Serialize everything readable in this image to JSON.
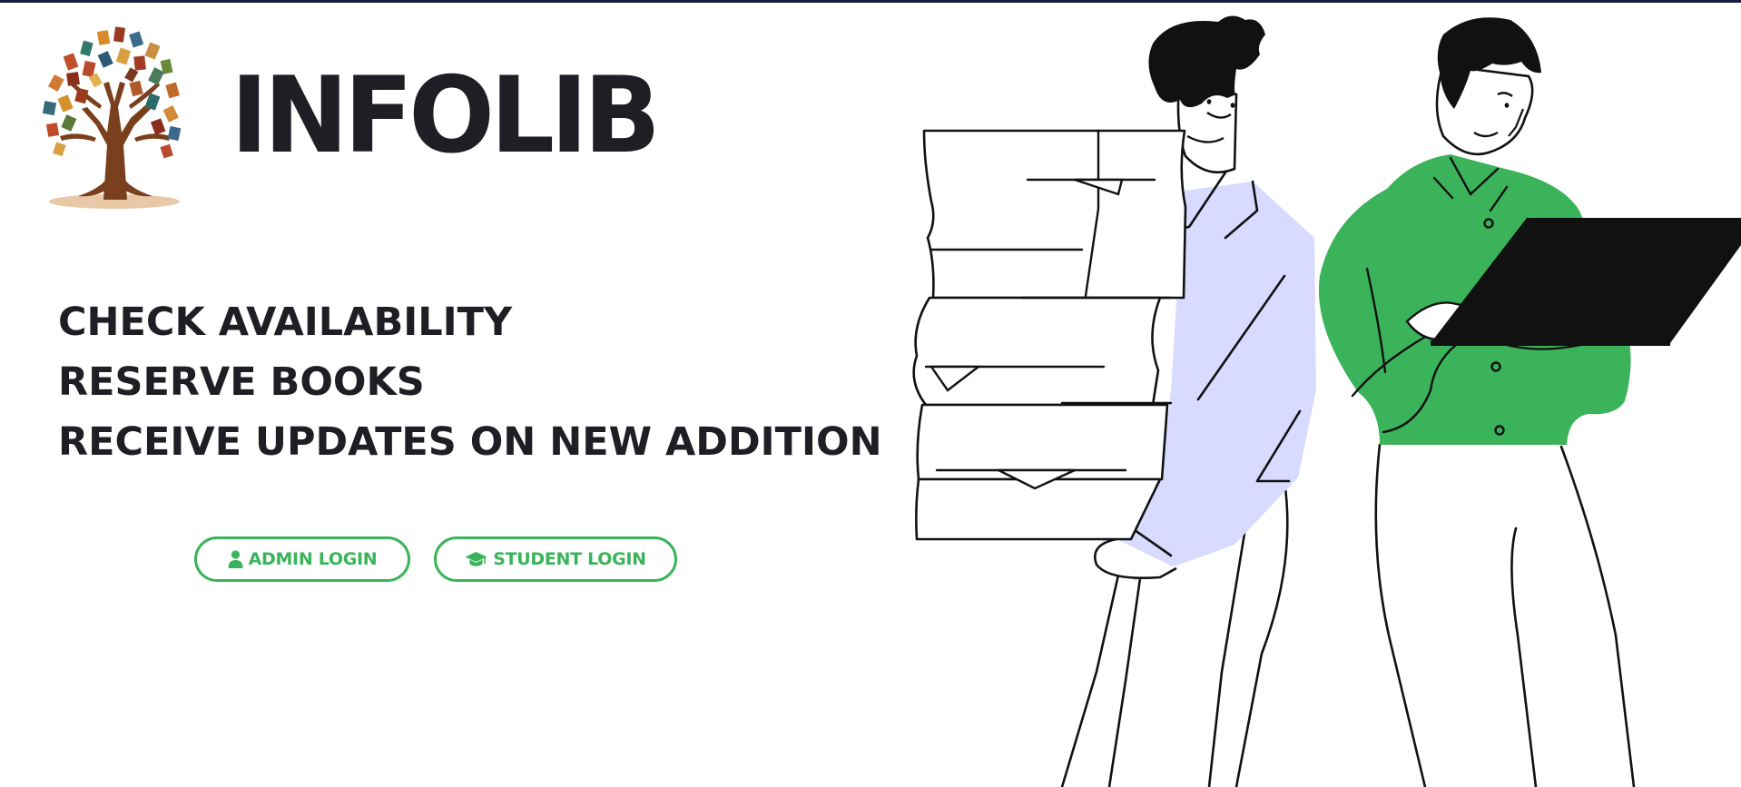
{
  "brand": {
    "name": "INFOLIB",
    "logo_icon": "book-tree-icon"
  },
  "taglines": [
    "CHECK AVAILABILITY",
    "RESERVE BOOKS",
    "RECEIVE UPDATES ON NEW ADDITION"
  ],
  "actions": {
    "admin_label": "ADMIN LOGIN",
    "admin_icon": "user-icon",
    "student_label": "STUDENT LOGIN",
    "student_icon": "graduation-cap-icon"
  },
  "colors": {
    "accent": "#3ab35a",
    "text": "#1e1e24",
    "shirt_lavender": "#d8dbff",
    "shirt_green": "#3ab35a"
  }
}
